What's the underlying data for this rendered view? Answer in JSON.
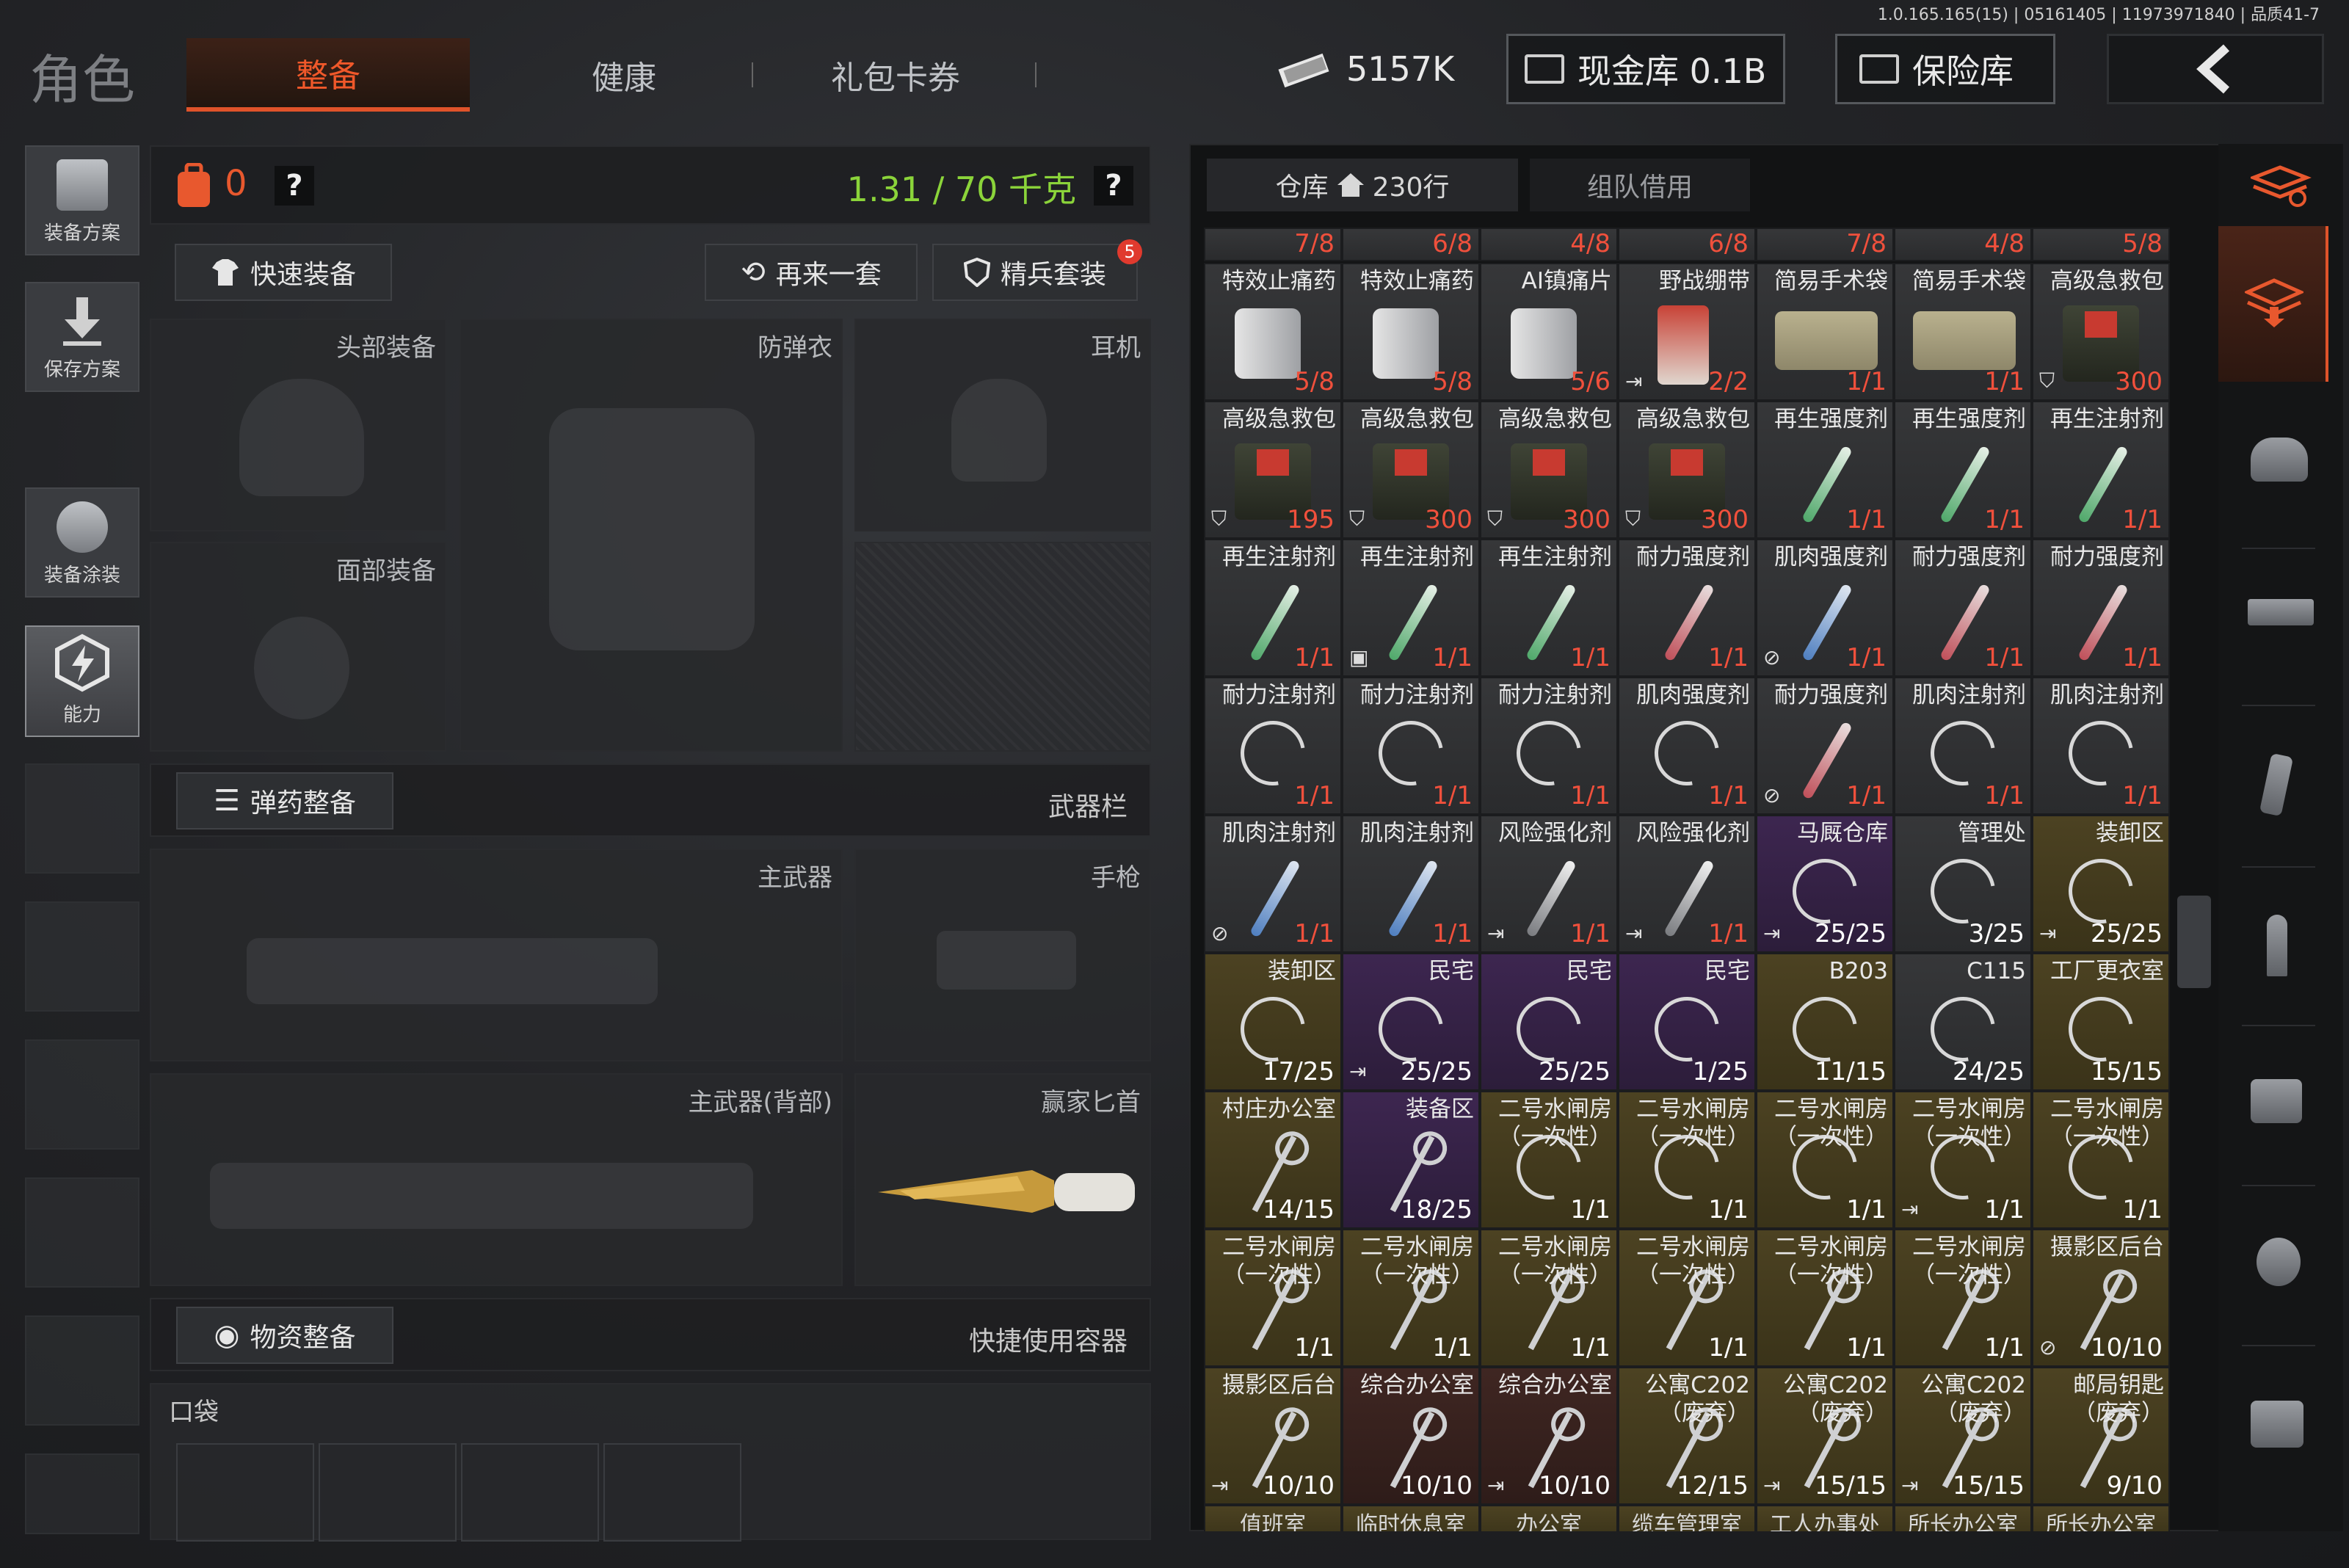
{
  "version": "1.0.165.165(15) | 05161405 | 11973971840 | 品质41-7",
  "header": {
    "title": "角色",
    "tabs": [
      {
        "label": "整备",
        "active": true
      },
      {
        "label": "健康",
        "active": false
      },
      {
        "label": "礼包卡券",
        "active": false
      }
    ],
    "money": "5157K",
    "cash_vault": "现金库 0.1B",
    "safe": "保险库",
    "back_icon": "chevron-left-icon"
  },
  "sidebar_left": {
    "items": [
      {
        "label": "装备方案"
      },
      {
        "label": "保存方案"
      },
      {
        "label": "装备涂装"
      },
      {
        "label": "能力"
      }
    ]
  },
  "loadout": {
    "backpack_count": "0",
    "help": "?",
    "weight": "1.31 / 70 千克",
    "weight_color": "#8bd43a",
    "quick_equip": "快速装备",
    "again_set": "再来一套",
    "elite_set": "精兵套装",
    "elite_badge": "5",
    "slots": {
      "head": "头部装备",
      "armor": "防弹衣",
      "headset": "耳机",
      "face": "面部装备",
      "primary": "主武器",
      "pistol": "手枪",
      "primary_back": "主武器(背部)",
      "knife": "赢家匕首"
    },
    "ammo_section": "弹药整备",
    "weapon_bar": "武器栏",
    "supply_section": "物资整备",
    "quick_container": "快捷使用容器",
    "pocket": "口袋"
  },
  "warehouse": {
    "tab_storage": "仓库",
    "rows": "230行",
    "tab_team": "组队借用",
    "top_partial_counts": [
      "7/8",
      "6/8",
      "4/8",
      "6/8",
      "7/8",
      "4/8",
      "5/8"
    ],
    "cells": [
      {
        "name": "特效止痛药",
        "count": "5/8",
        "red": true,
        "icon": "pill",
        "bg": "dark"
      },
      {
        "name": "特效止痛药",
        "count": "5/8",
        "red": true,
        "icon": "pill",
        "bg": "dark"
      },
      {
        "name": "AI镇痛片",
        "count": "5/6",
        "red": true,
        "icon": "pill",
        "bg": "dark"
      },
      {
        "name": "野战绷带",
        "count": "2/2",
        "red": true,
        "icon": "band",
        "bg": "dark",
        "badge": "exit"
      },
      {
        "name": "简易手术袋",
        "count": "1/1",
        "red": true,
        "icon": "bag",
        "bg": "dark"
      },
      {
        "name": "简易手术袋",
        "count": "1/1",
        "red": true,
        "icon": "bag",
        "bg": "dark"
      },
      {
        "name": "高级急救包",
        "count": "300",
        "red": true,
        "icon": "kit",
        "bg": "dark",
        "badge": "shield"
      },
      {
        "name": "高级急救包",
        "count": "195",
        "red": true,
        "icon": "kit",
        "bg": "dark",
        "badge": "shield"
      },
      {
        "name": "高级急救包",
        "count": "300",
        "red": true,
        "icon": "kit",
        "bg": "dark",
        "badge": "shield"
      },
      {
        "name": "高级急救包",
        "count": "300",
        "red": true,
        "icon": "kit",
        "bg": "dark",
        "badge": "shield"
      },
      {
        "name": "高级急救包",
        "count": "300",
        "red": true,
        "icon": "kit",
        "bg": "dark",
        "badge": "shield"
      },
      {
        "name": "再生强度剂",
        "count": "1/1",
        "red": true,
        "icon": "inj-green",
        "bg": "dark"
      },
      {
        "name": "再生强度剂",
        "count": "1/1",
        "red": true,
        "icon": "inj-green",
        "bg": "dark"
      },
      {
        "name": "再生注射剂",
        "count": "1/1",
        "red": true,
        "icon": "inj-green",
        "bg": "dark"
      },
      {
        "name": "再生注射剂",
        "count": "1/1",
        "red": true,
        "icon": "inj-green",
        "bg": "dark"
      },
      {
        "name": "再生注射剂",
        "count": "1/1",
        "red": true,
        "icon": "inj-green",
        "bg": "dark",
        "badge": "box"
      },
      {
        "name": "再生注射剂",
        "count": "1/1",
        "red": true,
        "icon": "inj-green",
        "bg": "dark"
      },
      {
        "name": "耐力强度剂",
        "count": "1/1",
        "red": true,
        "icon": "inj-red",
        "bg": "dark"
      },
      {
        "name": "肌肉强度剂",
        "count": "1/1",
        "red": true,
        "icon": "inj-blue",
        "bg": "dark",
        "badge": "nope"
      },
      {
        "name": "耐力强度剂",
        "count": "1/1",
        "red": true,
        "icon": "inj-red",
        "bg": "dark"
      },
      {
        "name": "耐力强度剂",
        "count": "1/1",
        "red": true,
        "icon": "inj-red",
        "bg": "dark"
      },
      {
        "name": "耐力注射剂",
        "count": "1/1",
        "red": true,
        "icon": "ring",
        "bg": "dark"
      },
      {
        "name": "耐力注射剂",
        "count": "1/1",
        "red": true,
        "icon": "ring",
        "bg": "dark"
      },
      {
        "name": "耐力注射剂",
        "count": "1/1",
        "red": true,
        "icon": "ring",
        "bg": "dark"
      },
      {
        "name": "肌肉强度剂",
        "count": "1/1",
        "red": true,
        "icon": "ring",
        "bg": "dark"
      },
      {
        "name": "耐力强度剂",
        "count": "1/1",
        "red": true,
        "icon": "inj-red",
        "bg": "dark",
        "badge": "nope"
      },
      {
        "name": "肌肉注射剂",
        "count": "1/1",
        "red": true,
        "icon": "ring",
        "bg": "dark"
      },
      {
        "name": "肌肉注射剂",
        "count": "1/1",
        "red": true,
        "icon": "ring",
        "bg": "dark"
      },
      {
        "name": "肌肉注射剂",
        "count": "1/1",
        "red": true,
        "icon": "inj-blue",
        "bg": "dark",
        "badge": "nope"
      },
      {
        "name": "肌肉注射剂",
        "count": "1/1",
        "red": true,
        "icon": "inj-blue",
        "bg": "dark"
      },
      {
        "name": "风险强化剂",
        "count": "1/1",
        "red": true,
        "icon": "inj-white",
        "bg": "dark",
        "badge": "exit"
      },
      {
        "name": "风险强化剂",
        "count": "1/1",
        "red": true,
        "icon": "inj-white",
        "bg": "dark",
        "badge": "exit"
      },
      {
        "name": "马厩仓库",
        "count": "25/25",
        "red": false,
        "icon": "ring",
        "bg": "purple",
        "badge": "exit"
      },
      {
        "name": "管理处",
        "count": "3/25",
        "red": false,
        "icon": "ring",
        "bg": "dark"
      },
      {
        "name": "装卸区",
        "count": "25/25",
        "red": false,
        "icon": "ring",
        "bg": "olive",
        "badge": "exit"
      },
      {
        "name": "装卸区",
        "count": "17/25",
        "red": false,
        "icon": "ring",
        "bg": "olive"
      },
      {
        "name": "民宅",
        "count": "25/25",
        "red": false,
        "icon": "ring",
        "bg": "purple",
        "badge": "exit"
      },
      {
        "name": "民宅",
        "count": "25/25",
        "red": false,
        "icon": "ring",
        "bg": "purple"
      },
      {
        "name": "民宅",
        "count": "1/25",
        "red": false,
        "icon": "ring",
        "bg": "purple"
      },
      {
        "name": "B203",
        "count": "11/15",
        "red": false,
        "icon": "ring",
        "bg": "olive"
      },
      {
        "name": "C115",
        "count": "24/25",
        "red": false,
        "icon": "ring",
        "bg": "dark"
      },
      {
        "name": "工厂更衣室",
        "count": "15/15",
        "red": false,
        "icon": "ring",
        "bg": "olive"
      },
      {
        "name": "村庄办公室",
        "count": "14/15",
        "red": false,
        "icon": "key",
        "bg": "olive"
      },
      {
        "name": "装备区",
        "count": "18/25",
        "red": false,
        "icon": "key",
        "bg": "purple"
      },
      {
        "name": "二号水闸房（一次性）",
        "count": "1/1",
        "red": false,
        "icon": "ring",
        "bg": "olive"
      },
      {
        "name": "二号水闸房（一次性）",
        "count": "1/1",
        "red": false,
        "icon": "ring",
        "bg": "olive"
      },
      {
        "name": "二号水闸房（一次性）",
        "count": "1/1",
        "red": false,
        "icon": "ring",
        "bg": "olive"
      },
      {
        "name": "二号水闸房（一次性）",
        "count": "1/1",
        "red": false,
        "icon": "ring",
        "bg": "olive",
        "badge": "exit"
      },
      {
        "name": "二号水闸房（一次性）",
        "count": "1/1",
        "red": false,
        "icon": "ring",
        "bg": "olive"
      },
      {
        "name": "二号水闸房（一次性）",
        "count": "1/1",
        "red": false,
        "icon": "key",
        "bg": "olive"
      },
      {
        "name": "二号水闸房（一次性）",
        "count": "1/1",
        "red": false,
        "icon": "key",
        "bg": "olive"
      },
      {
        "name": "二号水闸房（一次性）",
        "count": "1/1",
        "red": false,
        "icon": "key",
        "bg": "olive"
      },
      {
        "name": "二号水闸房（一次性）",
        "count": "1/1",
        "red": false,
        "icon": "key",
        "bg": "olive"
      },
      {
        "name": "二号水闸房（一次性）",
        "count": "1/1",
        "red": false,
        "icon": "key",
        "bg": "olive"
      },
      {
        "name": "二号水闸房（一次性）",
        "count": "1/1",
        "red": false,
        "icon": "key",
        "bg": "olive"
      },
      {
        "name": "摄影区后台",
        "count": "10/10",
        "red": false,
        "icon": "key",
        "bg": "olive",
        "badge": "nope"
      },
      {
        "name": "摄影区后台",
        "count": "10/10",
        "red": false,
        "icon": "key",
        "bg": "olive",
        "badge": "exit"
      },
      {
        "name": "综合办公室",
        "count": "10/10",
        "red": false,
        "icon": "key",
        "bg": "brown"
      },
      {
        "name": "综合办公室",
        "count": "10/10",
        "red": false,
        "icon": "key",
        "bg": "brown",
        "badge": "exit"
      },
      {
        "name": "公寓C202（废弃）",
        "count": "12/15",
        "red": false,
        "icon": "key",
        "bg": "olive"
      },
      {
        "name": "公寓C202（废弃）",
        "count": "15/15",
        "red": false,
        "icon": "key",
        "bg": "olive",
        "badge": "exit"
      },
      {
        "name": "公寓C202（废弃）",
        "count": "15/15",
        "red": false,
        "icon": "key",
        "bg": "olive",
        "badge": "exit"
      },
      {
        "name": "邮局钥匙（废弃）",
        "count": "9/10",
        "red": false,
        "icon": "key",
        "bg": "olive"
      }
    ],
    "bottom_partial_names": [
      "值班室",
      "临时休息室",
      "办公室",
      "缆车管理室",
      "工人办事处",
      "所长办公室",
      "所长办公室"
    ]
  },
  "sidebar_right": {
    "icons": [
      "stack-refresh-icon",
      "stack-download-icon",
      "helmet-icon",
      "rifle-icon",
      "magazine-icon",
      "bullet-icon",
      "armor-plate-icon",
      "grenade-icon",
      "container-icon"
    ]
  }
}
